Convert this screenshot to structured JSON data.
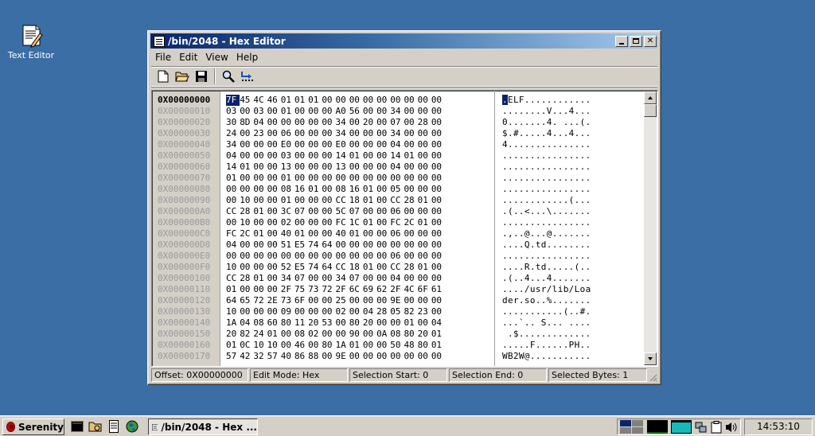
{
  "desktop": {
    "icons": [
      {
        "label": "Text Editor",
        "icon": "text-editor-icon"
      }
    ]
  },
  "window": {
    "title": "/bin/2048 - Hex Editor",
    "menu": [
      "File",
      "Edit",
      "View",
      "Help"
    ],
    "toolbar": [
      "new-file-icon",
      "open-folder-icon",
      "save-icon",
      "search-icon",
      "go-to-offset-icon"
    ]
  },
  "editor": {
    "selected_byte_index": 0,
    "offsets": [
      "0X00000000",
      "0X00000010",
      "0X00000020",
      "0X00000030",
      "0X00000040",
      "0X00000050",
      "0X00000060",
      "0X00000070",
      "0X00000080",
      "0X00000090",
      "0X000000A0",
      "0X000000B0",
      "0X000000C0",
      "0X000000D0",
      "0X000000E0",
      "0X000000F0",
      "0X00000100",
      "0X00000110",
      "0X00000120",
      "0X00000130",
      "0X00000140",
      "0X00000150",
      "0X00000160",
      "0X00000170"
    ],
    "hex": [
      "7F 45 4C 46 01 01 01 00 00 00 00 00 00 00 00 00",
      "03 00 03 00 01 00 00 00 A0 56 00 00 34 00 00 00",
      "30 8D 04 00 00 00 00 00 34 00 20 00 07 00 28 00",
      "24 00 23 00 06 00 00 00 34 00 00 00 34 00 00 00",
      "34 00 00 00 E0 00 00 00 E0 00 00 00 04 00 00 00",
      "04 00 00 00 03 00 00 00 14 01 00 00 14 01 00 00",
      "14 01 00 00 13 00 00 00 13 00 00 00 04 00 00 00",
      "01 00 00 00 01 00 00 00 00 00 00 00 00 00 00 00",
      "00 00 00 00 08 16 01 00 08 16 01 00 05 00 00 00",
      "00 10 00 00 01 00 00 00 CC 18 01 00 CC 28 01 00",
      "CC 28 01 00 3C 07 00 00 5C 07 00 00 06 00 00 00",
      "00 10 00 00 02 00 00 00 FC 1C 01 00 FC 2C 01 00",
      "FC 2C 01 00 40 01 00 00 40 01 00 00 06 00 00 00",
      "04 00 00 00 51 E5 74 64 00 00 00 00 00 00 00 00",
      "00 00 00 00 00 00 00 00 00 00 00 00 06 00 00 00",
      "10 00 00 00 52 E5 74 64 CC 18 01 00 CC 28 01 00",
      "CC 28 01 00 34 07 00 00 34 07 00 00 04 00 00 00",
      "01 00 00 00 2F 75 73 72 2F 6C 69 62 2F 4C 6F 61",
      "64 65 72 2E 73 6F 00 00 25 00 00 00 9E 00 00 00",
      "10 00 00 00 09 00 00 00 02 00 04 28 05 82 23 00",
      "1A 04 08 60 80 11 20 53 00 80 20 00 00 01 00 04",
      "20 82 24 01 00 08 02 00 00 90 00 0A 08 80 20 01",
      "01 0C 10 10 00 46 00 80 1A 01 00 00 50 48 80 01",
      "57 42 32 57 40 86 88 00 9E 00 00 00 00 00 00 00"
    ],
    "ascii": [
      ".ELF............",
      "........V...4...",
      "0.......4. ...(.",
      "$.#.....4...4...",
      "4...............",
      "................",
      "................",
      "................",
      "................",
      "............(...",
      ".(..<...\\.......",
      "................",
      ".,..@...@.......",
      "....Q.td........",
      "................",
      "....R.td.....(..",
      ".(..4...4.......",
      "..../usr/lib/Loa",
      "der.so..%.......",
      "...........(..#.",
      "...`.. S... ....",
      " .$.............",
      ".....F......PH..",
      "WB2W@..........."
    ]
  },
  "status": {
    "offset": "Offset: 0X00000000",
    "edit_mode": "Edit Mode: Hex",
    "selection_start": "Selection Start: 0",
    "selection_end": "Selection End: 0",
    "selected_bytes": "Selected Bytes: 1"
  },
  "taskbar": {
    "start_label": "Serenity",
    "quick_launch": [
      "terminal-icon",
      "file-manager-icon",
      "text-editor-icon",
      "browser-icon"
    ],
    "tasks": [
      {
        "label": "/bin/2048 - Hex ..."
      }
    ],
    "tray": [
      "workspace-switcher-icon",
      "cpu-graph-icon",
      "network-graph-icon",
      "network-icon",
      "clipboard-icon",
      "volume-icon"
    ],
    "clock": "14:53:10"
  }
}
